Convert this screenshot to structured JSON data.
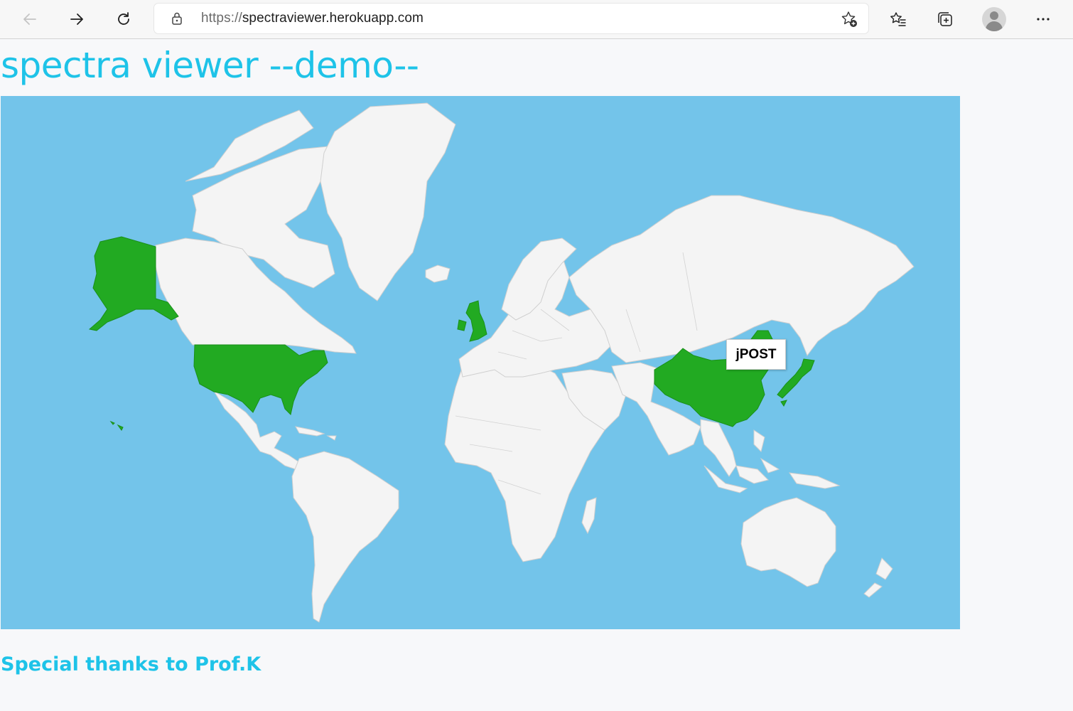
{
  "browser": {
    "url_protocol": "https://",
    "url_host": "spectraviewer.herokuapp.com"
  },
  "page": {
    "title": "spectra viewer --demo--",
    "footer_text": "Special thanks to Prof.K"
  },
  "map": {
    "highlighted_regions": [
      "United States",
      "United Kingdom",
      "China",
      "Japan"
    ],
    "highlight_color": "#22aa22",
    "ocean_color": "#73c4ea",
    "land_color": "#f4f4f4",
    "tooltip_text": "jPOST"
  },
  "colors": {
    "accent": "#1ec3e8"
  },
  "icons": {
    "back": "arrow-left-icon",
    "forward": "arrow-right-icon",
    "refresh": "refresh-icon",
    "lock": "lock-icon",
    "add_favorite": "star-plus-icon",
    "favorites": "favorites-list-icon",
    "collections": "collections-icon",
    "profile": "profile-avatar",
    "menu": "more-icon"
  }
}
